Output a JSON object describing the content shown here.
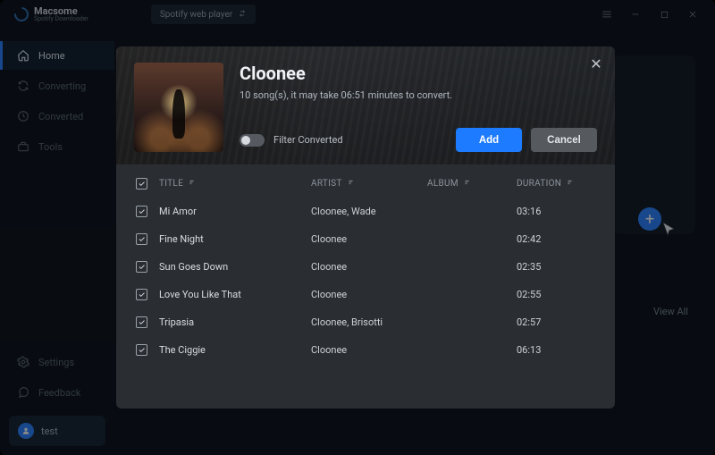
{
  "brand": {
    "name": "Macsome",
    "subtitle": "Spotify Downloader"
  },
  "titlebar": {
    "chip_label": "Spotify web player"
  },
  "sidebar": {
    "items": [
      {
        "label": "Home",
        "icon": "home-icon",
        "active": true
      },
      {
        "label": "Converting",
        "icon": "refresh-icon",
        "active": false
      },
      {
        "label": "Converted",
        "icon": "clock-icon",
        "active": false
      },
      {
        "label": "Tools",
        "icon": "toolbox-icon",
        "active": false
      }
    ],
    "footer": [
      {
        "label": "Settings",
        "icon": "gear-icon"
      },
      {
        "label": "Feedback",
        "icon": "chat-icon"
      }
    ],
    "user": {
      "name": "test"
    }
  },
  "main": {
    "view_all": "View All"
  },
  "modal": {
    "title": "Cloonee",
    "subtitle": "10 song(s), it may take 06:51 minutes to convert.",
    "filter_label": "Filter Converted",
    "add_label": "Add",
    "cancel_label": "Cancel",
    "columns": {
      "title": "TITLE",
      "artist": "ARTIST",
      "album": "ALBUM",
      "duration": "DURATION"
    },
    "tracks": [
      {
        "checked": true,
        "title": "Mi Amor",
        "artist": "Cloonee, Wade",
        "album": "",
        "duration": "03:16"
      },
      {
        "checked": true,
        "title": "Fine Night",
        "artist": "Cloonee",
        "album": "",
        "duration": "02:42"
      },
      {
        "checked": true,
        "title": "Sun Goes Down",
        "artist": "Cloonee",
        "album": "",
        "duration": "02:35"
      },
      {
        "checked": true,
        "title": "Love You Like That",
        "artist": "Cloonee",
        "album": "",
        "duration": "02:55"
      },
      {
        "checked": true,
        "title": "Tripasia",
        "artist": "Cloonee, Brisotti",
        "album": "",
        "duration": "02:57"
      },
      {
        "checked": true,
        "title": "The Ciggie",
        "artist": "Cloonee",
        "album": "",
        "duration": "06:13"
      }
    ]
  }
}
